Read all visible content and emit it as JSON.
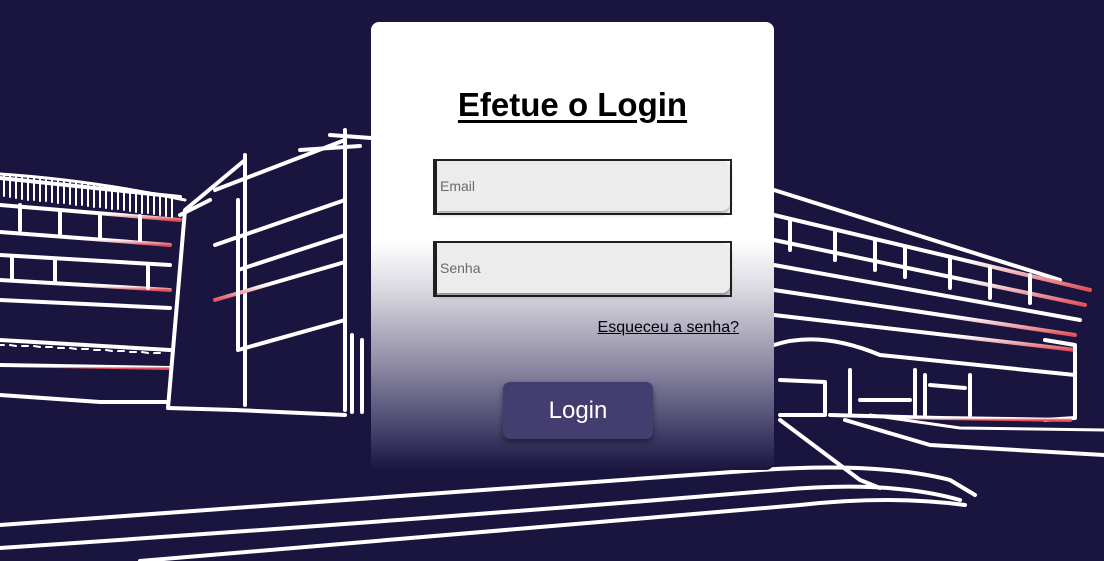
{
  "colors": {
    "background": "#19153f",
    "card": "#ffffff",
    "button": "#443d70",
    "line": "#ffffff",
    "accent_line": "#e0505a"
  },
  "login": {
    "title": "Efetue o Login",
    "email_placeholder": "Email",
    "password_placeholder": "Senha",
    "forgot_password": "Esqueceu a senha?",
    "submit_label": "Login"
  },
  "icons": {
    "background": "building-line-art"
  }
}
